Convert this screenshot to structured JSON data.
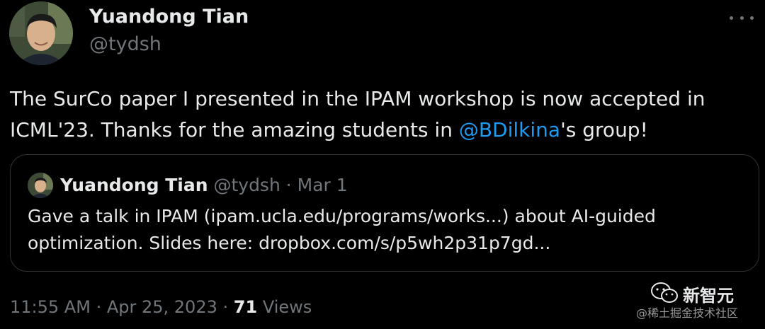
{
  "author": {
    "name": "Yuandong Tian",
    "handle": "@tydsh"
  },
  "tweet": {
    "text_part1": "The SurCo paper I presented in the IPAM workshop is now accepted in ICML'23. Thanks for the amazing students in ",
    "mention": "@BDilkina",
    "text_part2": "'s group!"
  },
  "quoted_tweet": {
    "name": "Yuandong Tian",
    "handle": "@tydsh",
    "separator": "·",
    "date": "Mar 1",
    "text": "Gave a talk in IPAM (ipam.ucla.edu/programs/works...) about AI-guided optimization. Slides here: dropbox.com/s/p5wh2p31p7gd..."
  },
  "footer": {
    "time": "11:55 AM",
    "separator": "·",
    "date": "Apr 25, 2023",
    "views_count": "71",
    "views_label": "Views"
  },
  "watermark": {
    "title": "新智元",
    "subtitle": "@稀土掘金技术社区"
  },
  "colors": {
    "background": "#000000",
    "text": "#e7e9ea",
    "secondary": "#71767b",
    "link": "#1d9bf0",
    "border": "#2f3336"
  },
  "icons": [
    "more-options-icon",
    "wechat-icon"
  ]
}
